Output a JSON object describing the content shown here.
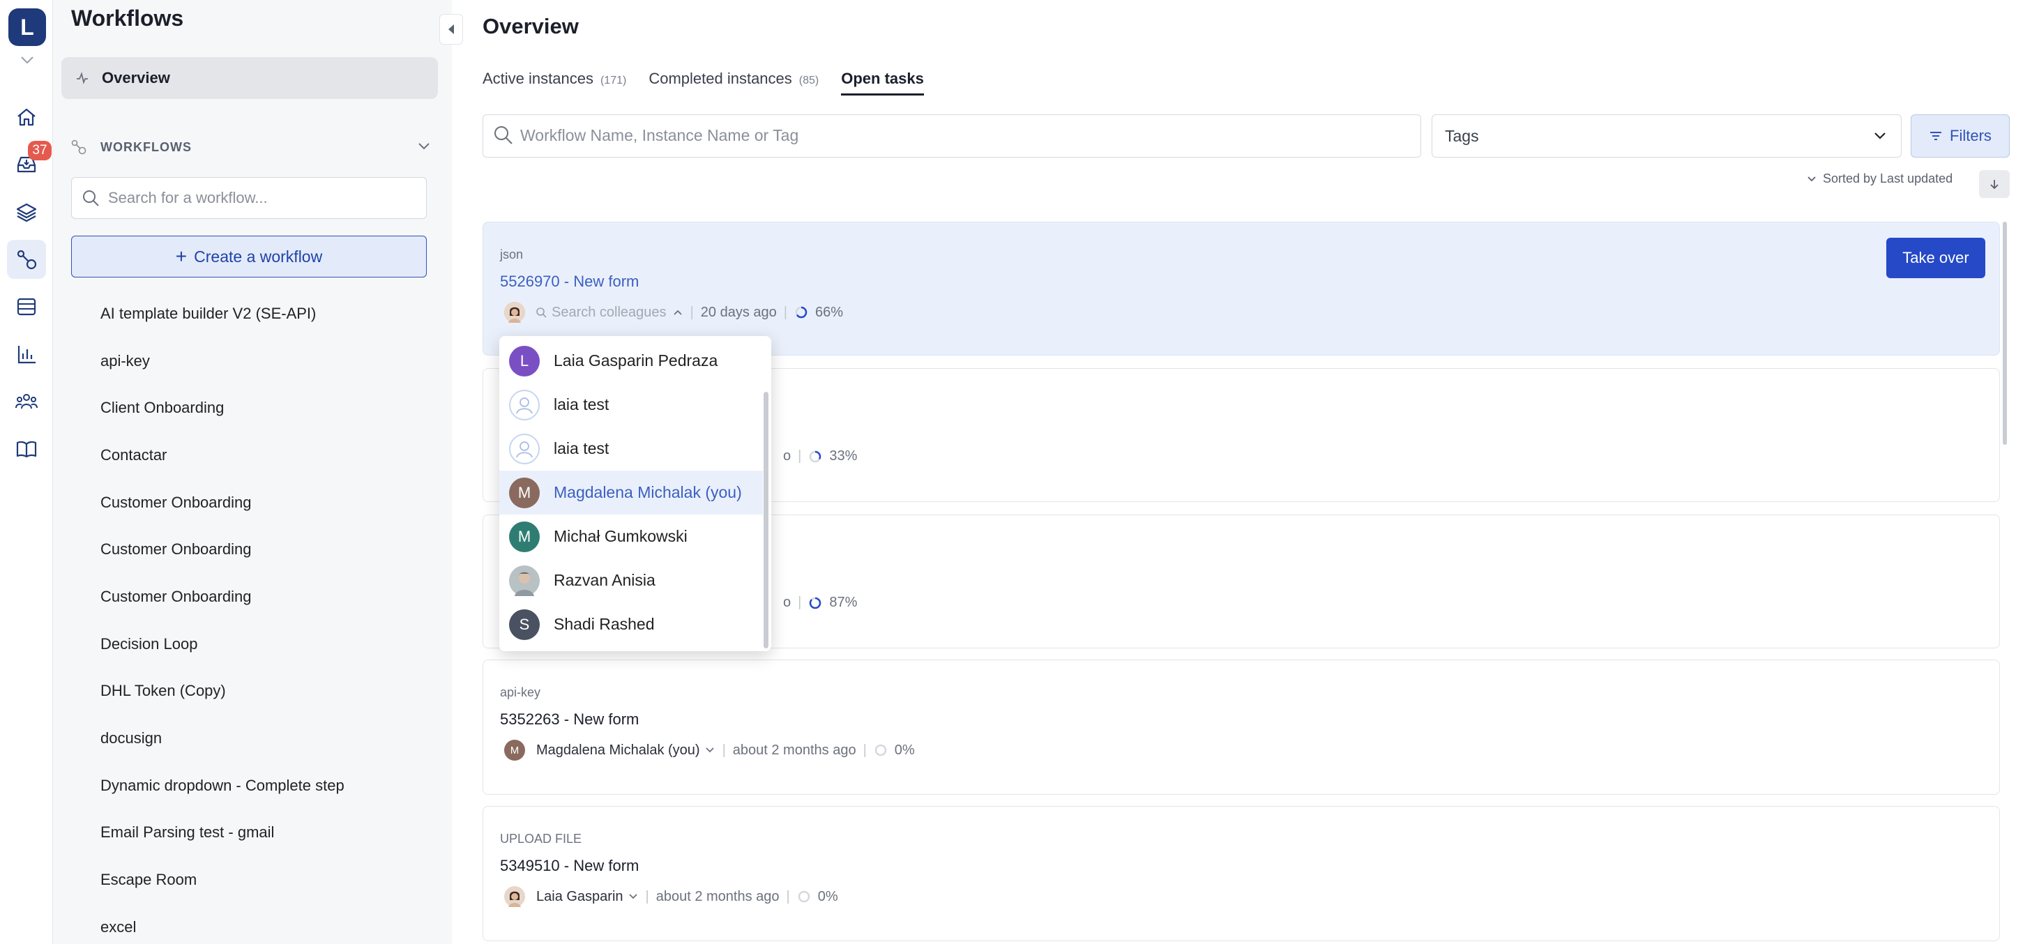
{
  "rail": {
    "logo_letter": "L",
    "inbox_badge": "37",
    "icons": [
      "home-icon",
      "inbox-icon",
      "layers-icon",
      "workflow-icon",
      "list-icon",
      "chart-icon",
      "team-icon",
      "book-icon"
    ]
  },
  "sidebar": {
    "title": "Workflows",
    "overview_label": "Overview",
    "section_label": "WORKFLOWS",
    "search_placeholder": "Search for a workflow...",
    "create_label": "Create a workflow",
    "items": [
      "AI template builder V2 (SE-API)",
      "api-key",
      "Client Onboarding",
      "Contactar",
      "Customer Onboarding",
      "Customer Onboarding",
      "Customer Onboarding",
      "Decision Loop",
      "DHL Token (Copy)",
      "docusign",
      "Dynamic dropdown - Complete step",
      "Email Parsing test - gmail",
      "Escape Room",
      "excel"
    ]
  },
  "main": {
    "title": "Overview",
    "tabs": [
      {
        "label": "Active instances",
        "count": "(171)"
      },
      {
        "label": "Completed instances",
        "count": "(85)"
      },
      {
        "label": "Open tasks",
        "count": ""
      }
    ],
    "search_placeholder": "Workflow Name, Instance Name or Tag",
    "tags_label": "Tags",
    "filters_label": "Filters",
    "sort_label": "Sorted by Last updated"
  },
  "cards": [
    {
      "workflow": "json",
      "id": "5526970",
      "sep": " - ",
      "name": "New form",
      "assignee": "Search colleagues",
      "time": "20 days ago",
      "progress_text": "66%",
      "progress": 0.66,
      "action": "Take over"
    },
    {
      "workflow": "",
      "id": "",
      "sep": "",
      "name": "",
      "assignee": "",
      "time_tail": "o",
      "progress_text": "33%",
      "progress": 0.33
    },
    {
      "workflow": "",
      "id": "",
      "sep": "",
      "name": "",
      "assignee": "",
      "time_tail": "o",
      "progress_text": "87%",
      "progress": 0.87
    },
    {
      "workflow": "api-key",
      "id": "5352263",
      "sep": " - ",
      "name": "New form",
      "assignee": "Magdalena Michalak (you)",
      "assignee_initial": "M",
      "time": "about 2 months ago",
      "progress_text": "0%",
      "progress": 0
    },
    {
      "workflow": "UPLOAD FILE",
      "id": "5349510",
      "sep": " - ",
      "name": "New form",
      "assignee": "Laia Gasparin",
      "time": "about 2 months ago",
      "progress_text": "0%",
      "progress": 0
    }
  ],
  "dropdown": {
    "items": [
      {
        "name": "Laia Gasparin Pedraza",
        "initial": "L",
        "color": "#7b4fc4",
        "kind": "letter"
      },
      {
        "name": "laia test",
        "initial": "",
        "color": "",
        "kind": "placeholder"
      },
      {
        "name": "laia test",
        "initial": "",
        "color": "",
        "kind": "placeholder"
      },
      {
        "name": "Magdalena Michalak (you)",
        "initial": "M",
        "color": "#8a6a5e",
        "kind": "letter",
        "selected": true
      },
      {
        "name": "Michał Gumkowski",
        "initial": "M",
        "color": "#2e7d72",
        "kind": "letter"
      },
      {
        "name": "Razvan Anisia",
        "initial": "",
        "color": "#9aa4a6",
        "kind": "photo"
      },
      {
        "name": "Shadi Rashed",
        "initial": "S",
        "color": "#4a5160",
        "kind": "letter"
      }
    ]
  },
  "colors": {
    "brand": "#1f3a7a",
    "primary": "#2549c7",
    "accent_link": "#3b5fc0",
    "badge": "#e55a4e",
    "highlight_bg": "#eaf0fb"
  }
}
